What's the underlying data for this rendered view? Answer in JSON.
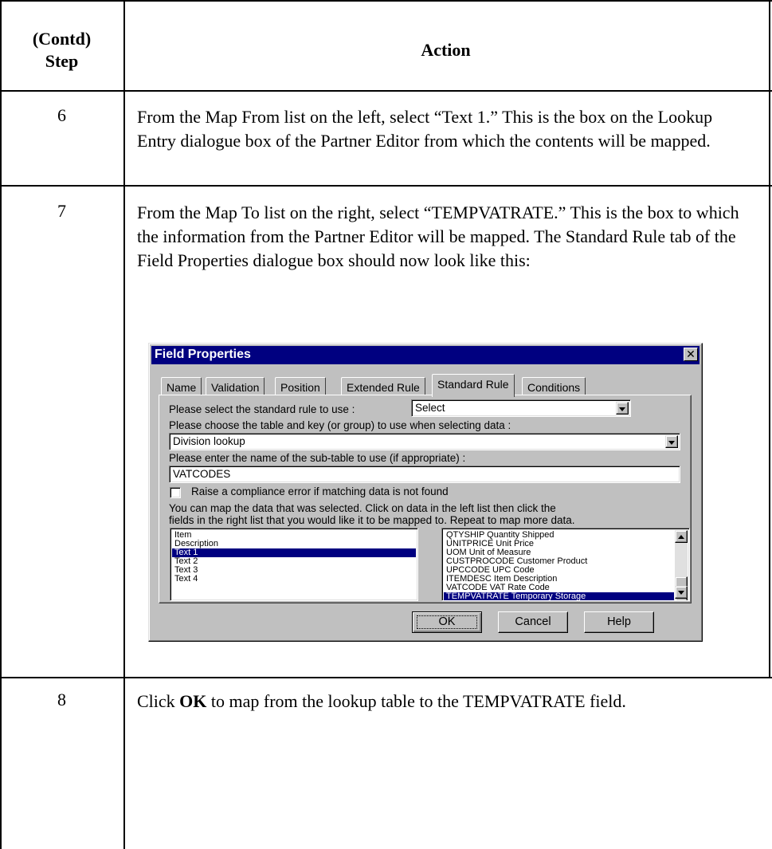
{
  "header": {
    "step_label_line1": "(Contd)",
    "step_label_line2": "Step",
    "action_label": "Action"
  },
  "steps": [
    {
      "number": "6",
      "text": "From the Map From list on the left, select “Text 1.” This is the box on the Lookup Entry dialogue box of the Partner Editor from which the contents will be mapped."
    },
    {
      "number": "7",
      "text": "From the Map To list on the right, select “TEMPVATRATE.” This is the box to which the information from the Partner Editor will be mapped. The Standard Rule tab of the Field Properties dialogue box should now look like this:"
    },
    {
      "number": "8",
      "text_before": "Click ",
      "text_bold": "OK",
      "text_after": " to map from the lookup table to the TEMPVATRATE field."
    }
  ],
  "dialog": {
    "title": "Field Properties",
    "close_glyph": "✕",
    "tabs": [
      "Name",
      "Validation",
      "Position",
      "Extended Rule",
      "Standard Rule",
      "Conditions"
    ],
    "active_tab": "Standard Rule",
    "rule_label": "Please select the standard rule to use :",
    "rule_value": "Select",
    "table_label": "Please choose the table and key (or group) to use when selecting data :",
    "table_value": "Division lookup",
    "subtable_label": "Please enter the name of the sub-table to use (if appropriate) :",
    "subtable_value": "VATCODES",
    "checkbox_label": "Raise a compliance error if matching data is not found",
    "instructions_line1": "You can map the data that was selected. Click on data in the left list then click the",
    "instructions_line2": "fields in the right list that you would like it to be mapped to. Repeat to map more data.",
    "map_from": [
      "Item",
      "Description",
      "Text 1",
      "Text 2",
      "Text 3",
      "Text 4"
    ],
    "map_from_selected": "Text 1",
    "map_to": [
      "QTYSHIP Quantity Shipped",
      "UNITPRICE Unit Price",
      "UOM Unit of Measure",
      "CUSTPROCODE Customer Product",
      "UPCCODE UPC Code",
      "ITEMDESC Item Description",
      "VATCODE VAT Rate Code",
      "TEMPVATRATE Temporary Storage"
    ],
    "map_to_selected": "TEMPVATRATE Temporary Storage",
    "buttons": {
      "ok": "OK",
      "cancel": "Cancel",
      "help": "Help"
    }
  }
}
